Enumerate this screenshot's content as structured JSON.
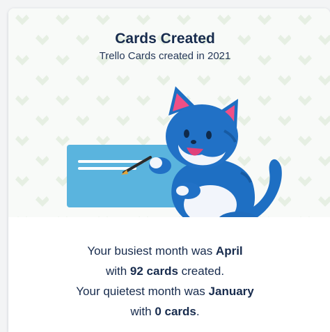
{
  "card": {
    "title": "Cards Created",
    "subtitle": "Trello Cards created in 2021"
  },
  "stats": {
    "busiest_prefix": "Your busiest month was ",
    "busiest_month": "April",
    "busiest_with": "with ",
    "busiest_count": "92 cards",
    "busiest_suffix": " created.",
    "quietest_prefix": "Your quietest month was ",
    "quietest_month": "January",
    "quietest_with": "with ",
    "quietest_count": "0 cards",
    "quietest_suffix": "."
  },
  "colors": {
    "mascot_blue": "#1e6fc3",
    "card_blue": "#5ab4de",
    "pattern_green": "#e6efe3"
  },
  "icons": {
    "mascot": "cat-mascot-icon"
  }
}
